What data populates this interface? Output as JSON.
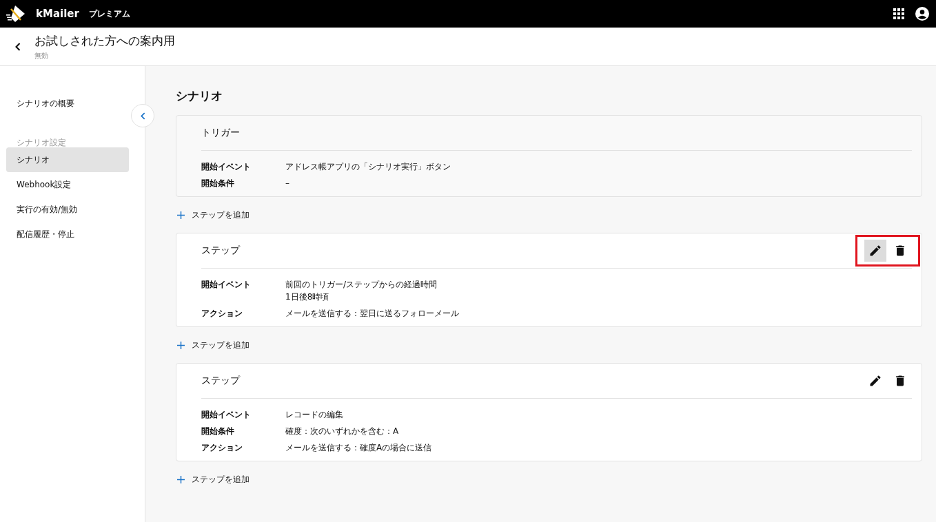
{
  "app": {
    "name": "kMailer",
    "plan": "プレミアム"
  },
  "header": {
    "title": "お試しされた方への案内用",
    "status": "無効"
  },
  "sidebar": {
    "items": [
      {
        "kind": "link",
        "label": "シナリオの概要",
        "selected": false
      },
      {
        "kind": "heading",
        "label": "シナリオ設定"
      },
      {
        "kind": "link",
        "label": "シナリオ",
        "selected": true
      },
      {
        "kind": "link",
        "label": "Webhook設定",
        "selected": false
      },
      {
        "kind": "link",
        "label": "実行の有効/無効",
        "selected": false
      },
      {
        "kind": "link",
        "label": "配信履歴・停止",
        "selected": false
      }
    ]
  },
  "section_title": "シナリオ",
  "blocks": [
    {
      "kind": "trigger",
      "title": "トリガー",
      "rows": [
        {
          "label": "開始イベント",
          "lines": [
            "アドレス帳アプリの「シナリオ実行」ボタン"
          ]
        },
        {
          "label": "開始条件",
          "lines": [
            "–"
          ]
        }
      ]
    },
    {
      "kind": "add",
      "label": "ステップを追加"
    },
    {
      "kind": "step",
      "title": "ステップ",
      "highlighted": true,
      "edit_hovered": true,
      "rows": [
        {
          "label": "開始イベント",
          "lines": [
            "前回のトリガー/ステップからの経過時間",
            "1日後8時頃"
          ]
        },
        {
          "label": "アクション",
          "lines": [
            "メールを送信する：翌日に送るフォローメール"
          ]
        }
      ]
    },
    {
      "kind": "add",
      "label": "ステップを追加"
    },
    {
      "kind": "step",
      "title": "ステップ",
      "highlighted": false,
      "edit_hovered": false,
      "rows": [
        {
          "label": "開始イベント",
          "lines": [
            "レコードの編集"
          ]
        },
        {
          "label": "開始条件",
          "lines": [
            "確度：次のいずれかを含む：A"
          ]
        },
        {
          "label": "アクション",
          "lines": [
            "メールを送信する：確度Aの場合に送信"
          ]
        }
      ]
    },
    {
      "kind": "add",
      "label": "ステップを追加"
    }
  ]
}
